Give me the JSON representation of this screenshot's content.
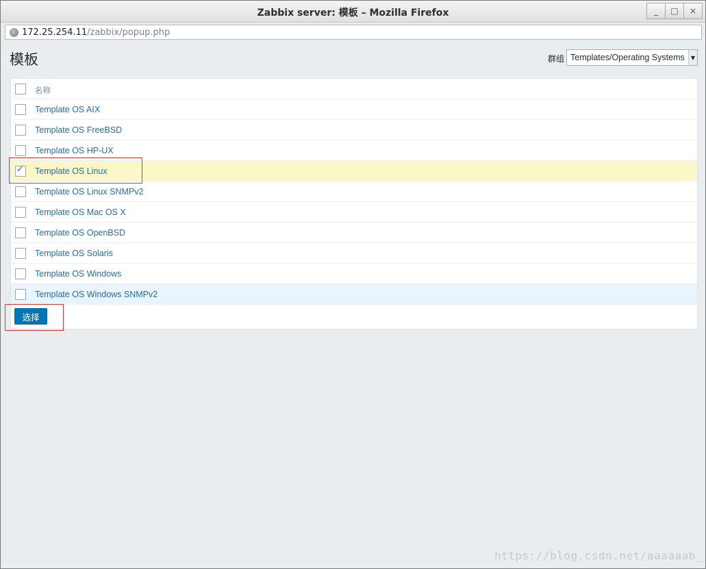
{
  "window": {
    "title": "Zabbix server: 模板 – Mozilla Firefox",
    "buttons": {
      "minimize": "_",
      "maximize": "□",
      "close": "×"
    }
  },
  "urlbar": {
    "host": "172.25.254.11",
    "path": "/zabbix/popup.php"
  },
  "page": {
    "title": "模板",
    "group_label": "群组",
    "group_selected": "Templates/Operating Systems"
  },
  "table": {
    "header": "名称",
    "rows": [
      {
        "label": "Template OS AIX",
        "checked": false
      },
      {
        "label": "Template OS FreeBSD",
        "checked": false
      },
      {
        "label": "Template OS HP-UX",
        "checked": false
      },
      {
        "label": "Template OS Linux",
        "checked": true
      },
      {
        "label": "Template OS Linux SNMPv2",
        "checked": false
      },
      {
        "label": "Template OS Mac OS X",
        "checked": false
      },
      {
        "label": "Template OS OpenBSD",
        "checked": false
      },
      {
        "label": "Template OS Solaris",
        "checked": false
      },
      {
        "label": "Template OS Windows",
        "checked": false
      },
      {
        "label": "Template OS Windows SNMPv2",
        "checked": false
      }
    ]
  },
  "select_button": "选择",
  "watermark": "https://blog.csdn.net/aaaaaab_",
  "colors": {
    "link": "#1f6ea8",
    "primary_button": "#0275b8",
    "checked_row": "#fcf7c6",
    "hover_row": "#e8f5ff",
    "annotation": "#d23a3a"
  }
}
